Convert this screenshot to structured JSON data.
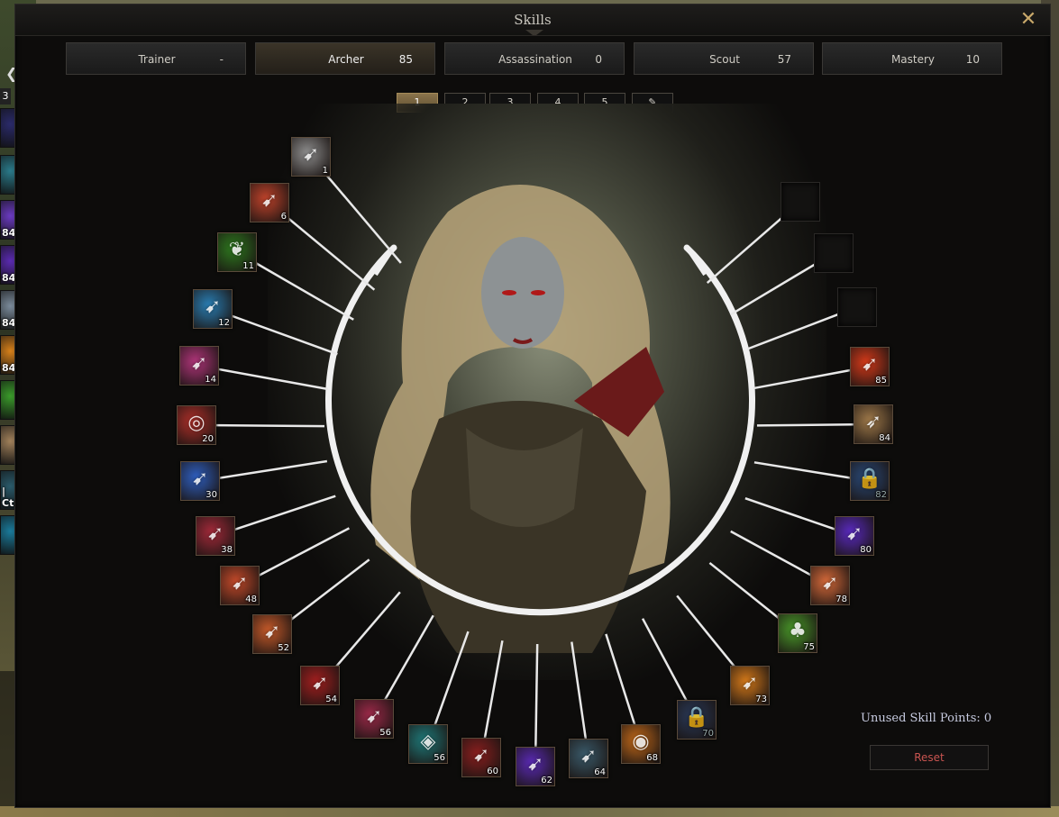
{
  "window": {
    "title": "Skills"
  },
  "trees": [
    {
      "label": "Trainer",
      "points": "-"
    },
    {
      "label": "Archer",
      "points": "85",
      "active": true
    },
    {
      "label": "Assassination",
      "points": "0"
    },
    {
      "label": "Scout",
      "points": "57"
    },
    {
      "label": "Mastery",
      "points": "10"
    }
  ],
  "loadouts": [
    "1",
    "2",
    "3",
    "4",
    "5"
  ],
  "active_loadout": "1",
  "skills_left": [
    {
      "level": "1",
      "icon": "arrows-crossed-icon",
      "color": "#8e8e8e"
    },
    {
      "level": "6",
      "icon": "flaming-arrow-icon",
      "color": "#c0432b"
    },
    {
      "level": "11",
      "icon": "green-leaf-icon",
      "color": "#2e7a1f"
    },
    {
      "level": "12",
      "icon": "ice-arrow-icon",
      "color": "#2a7fb5"
    },
    {
      "level": "14",
      "icon": "pink-star-arrows-icon",
      "color": "#b0357a"
    },
    {
      "level": "20",
      "icon": "target-icon",
      "color": "#b0302a"
    },
    {
      "level": "30",
      "icon": "blue-arrows-icon",
      "color": "#2f5fc0"
    },
    {
      "level": "38",
      "icon": "red-arrows-icon",
      "color": "#a32a3a"
    },
    {
      "level": "48",
      "icon": "arrow-burst-icon",
      "color": "#c44a2a"
    },
    {
      "level": "52",
      "icon": "fire-swirl-icon",
      "color": "#c65a2a"
    },
    {
      "level": "54",
      "icon": "red-arrow-icon",
      "color": "#a31f1f"
    },
    {
      "level": "56",
      "icon": "triple-arrows-icon",
      "color": "#9e2a4a"
    },
    {
      "level": "56",
      "icon": "teal-shield-icon",
      "color": "#1f7a7a"
    },
    {
      "level": "60",
      "icon": "blood-arrows-icon",
      "color": "#8a1f1f"
    },
    {
      "level": "62",
      "icon": "purple-spark-icon",
      "color": "#5a2ab5"
    },
    {
      "level": "64",
      "icon": "dark-arrows-icon",
      "color": "#3a5a6a"
    },
    {
      "level": "68",
      "icon": "fire-ring-icon",
      "color": "#c46a1a"
    },
    {
      "level": "70",
      "icon": "lock-icon",
      "color": "#2a3a5a",
      "locked": true
    }
  ],
  "skills_right": [
    {
      "level": "85",
      "icon": "fire-arrow-icon",
      "color": "#d63a1a"
    },
    {
      "level": "84",
      "icon": "quiver-icon",
      "color": "#a07a4a"
    },
    {
      "level": "82",
      "icon": "lock-icon",
      "color": "#2a4a7a",
      "locked": true
    },
    {
      "level": "80",
      "icon": "violet-arrow-icon",
      "color": "#5a2ac0"
    },
    {
      "level": "78",
      "icon": "bright-arrow-icon",
      "color": "#d66a3a"
    },
    {
      "level": "75",
      "icon": "mushroom-icon",
      "color": "#4a9a2a"
    },
    {
      "level": "73",
      "icon": "golden-arrow-icon",
      "color": "#d67a1a"
    }
  ],
  "left_bar": [
    {
      "label": "",
      "color": "#2a2a6a"
    },
    {
      "label": "",
      "color": "#2a7a8a"
    },
    {
      "label": "84",
      "color": "#6a3ac0"
    },
    {
      "label": "84",
      "color": "#5a2ab0"
    },
    {
      "label": "84",
      "color": "#7a8a9a"
    },
    {
      "label": "84",
      "color": "#d6801a"
    },
    {
      "label": "",
      "color": "#3a9a2a"
    },
    {
      "label": "",
      "color": "#a0805a"
    },
    {
      "label": "| Ctrl",
      "color": "#2a5a6a"
    },
    {
      "label": "",
      "color": "#1a7a9a"
    }
  ],
  "footer": {
    "unused_points": "Unused Skill Points: 0",
    "reset": "Reset"
  }
}
